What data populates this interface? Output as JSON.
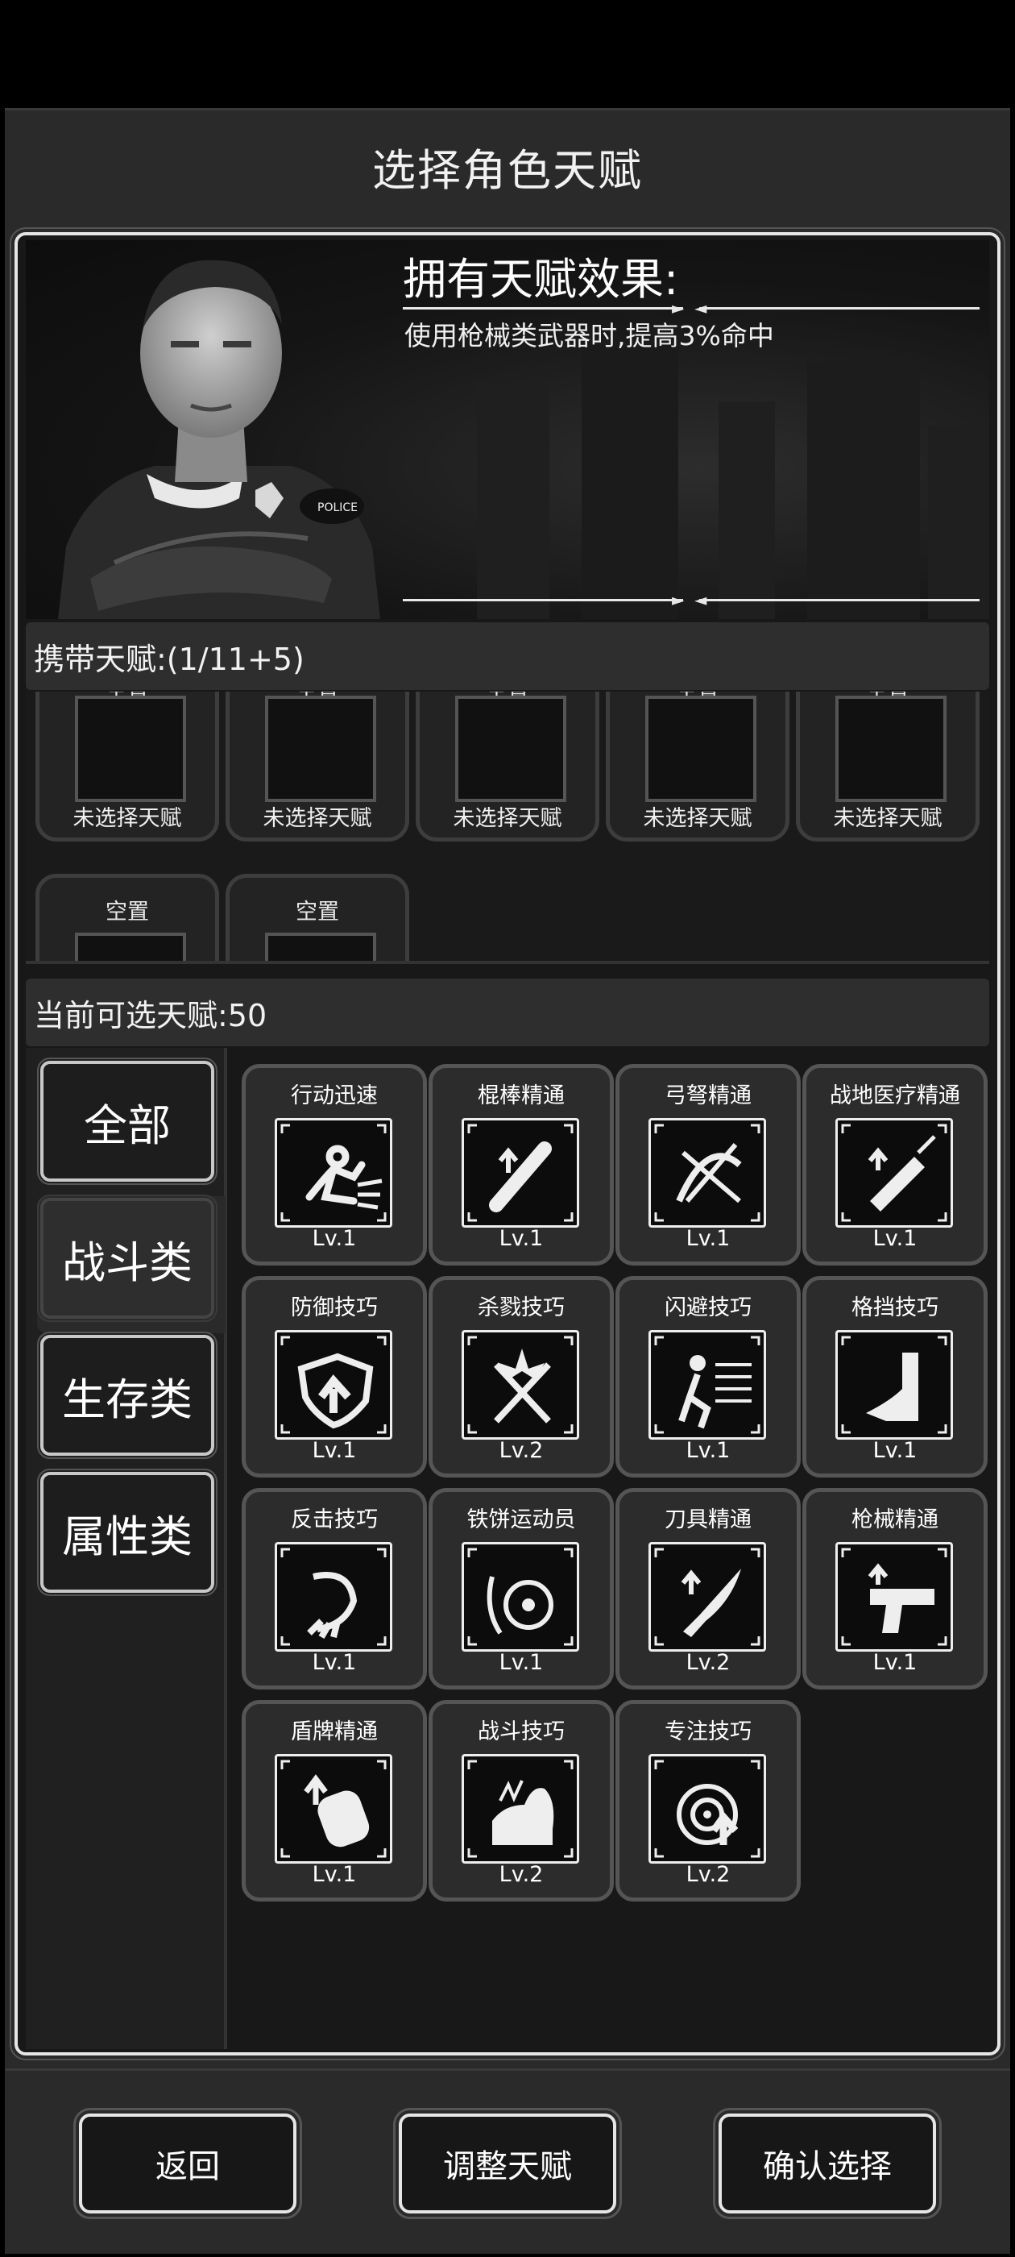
{
  "header": {
    "title": "选择角色天赋"
  },
  "character_panel": {
    "effect_title": "拥有天赋效果:",
    "effect_text": "使用枪械类武器时,提高3%命中",
    "portrait_badge": "POLICE"
  },
  "carried": {
    "header": "携带天赋:(1/11+5)",
    "slots": [
      {
        "top_label": "空置",
        "status": "未选择天赋"
      },
      {
        "top_label": "空置",
        "status": "未选择天赋"
      },
      {
        "top_label": "空置",
        "status": "未选择天赋"
      },
      {
        "top_label": "空置",
        "status": "未选择天赋"
      },
      {
        "top_label": "空置",
        "status": "未选择天赋"
      },
      {
        "top_label": "空置",
        "status": ""
      },
      {
        "top_label": "空置",
        "status": ""
      }
    ]
  },
  "available": {
    "header": "当前可选天赋:50",
    "categories": [
      {
        "label": "全部",
        "active": false
      },
      {
        "label": "战斗类",
        "active": true
      },
      {
        "label": "生存类",
        "active": false
      },
      {
        "label": "属性类",
        "active": false
      }
    ],
    "talents": [
      {
        "name": "行动迅速",
        "level": "Lv.1",
        "icon": "run-icon"
      },
      {
        "name": "棍棒精通",
        "level": "Lv.1",
        "icon": "club-icon"
      },
      {
        "name": "弓弩精通",
        "level": "Lv.1",
        "icon": "crossbow-icon"
      },
      {
        "name": "战地医疗精通",
        "level": "Lv.1",
        "icon": "syringe-icon"
      },
      {
        "name": "防御技巧",
        "level": "Lv.1",
        "icon": "shield-icon"
      },
      {
        "name": "杀戮技巧",
        "level": "Lv.2",
        "icon": "crossed-blades-icon"
      },
      {
        "name": "闪避技巧",
        "level": "Lv.1",
        "icon": "dodge-icon"
      },
      {
        "name": "格挡技巧",
        "level": "Lv.1",
        "icon": "block-arm-icon"
      },
      {
        "name": "反击技巧",
        "level": "Lv.1",
        "icon": "counter-claw-icon"
      },
      {
        "name": "铁饼运动员",
        "level": "Lv.1",
        "icon": "discus-icon"
      },
      {
        "name": "刀具精通",
        "level": "Lv.2",
        "icon": "machete-icon"
      },
      {
        "name": "枪械精通",
        "level": "Lv.1",
        "icon": "pistol-icon"
      },
      {
        "name": "盾牌精通",
        "level": "Lv.1",
        "icon": "riot-shield-icon"
      },
      {
        "name": "战斗技巧",
        "level": "Lv.2",
        "icon": "flexed-arm-icon"
      },
      {
        "name": "专注技巧",
        "level": "Lv.2",
        "icon": "target-icon"
      }
    ]
  },
  "footer": {
    "back_label": "返回",
    "adjust_label": "调整天赋",
    "confirm_label": "确认选择"
  }
}
